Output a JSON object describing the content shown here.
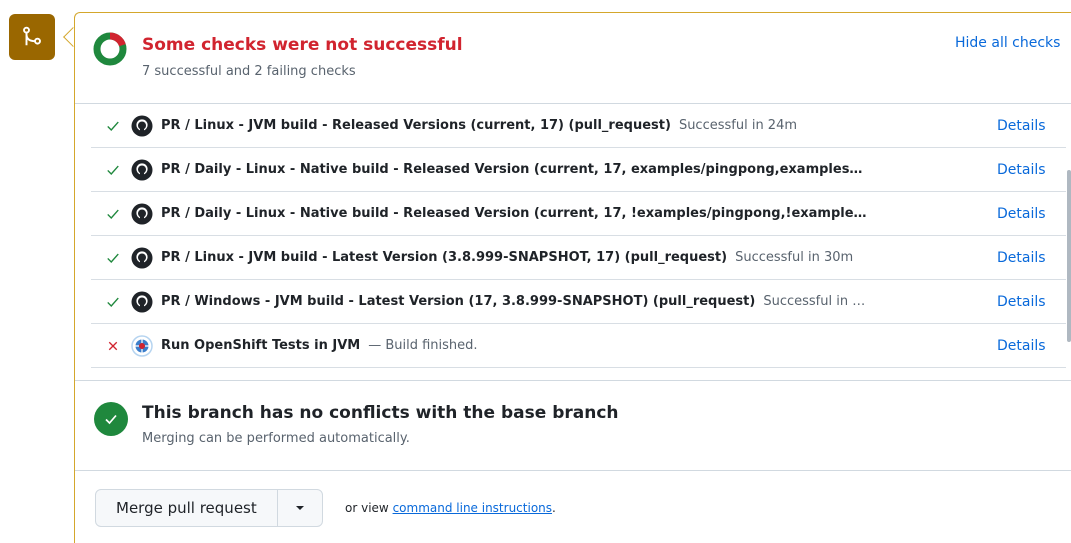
{
  "status": {
    "title": "Some checks were not successful",
    "subtitle": "7 successful and 2 failing checks",
    "hide_label": "Hide all checks",
    "success_color": "#1f883d",
    "fail_color": "#d1242f"
  },
  "checks": [
    {
      "status": "success",
      "avatar": "github-icon",
      "name": "PR / Linux - JVM build - Released Versions (current, 17) (pull_request)",
      "desc": "Successful in 24m",
      "details": "Details"
    },
    {
      "status": "success",
      "avatar": "github-icon",
      "name": "PR / Daily - Linux - Native build - Released Version (current, 17, examples/pingpong,examples…",
      "desc": "",
      "details": "Details"
    },
    {
      "status": "success",
      "avatar": "github-icon",
      "name": "PR / Daily - Linux - Native build - Released Version (current, 17, !examples/pingpong,!example…",
      "desc": "",
      "details": "Details"
    },
    {
      "status": "success",
      "avatar": "github-icon",
      "name": "PR / Linux - JVM build - Latest Version (3.8.999-SNAPSHOT, 17) (pull_request)",
      "desc": "Successful in 30m",
      "details": "Details"
    },
    {
      "status": "success",
      "avatar": "github-icon",
      "name": "PR / Windows - JVM build - Latest Version (17, 3.8.999-SNAPSHOT) (pull_request)",
      "desc": "Successful in …",
      "details": "Details"
    },
    {
      "status": "failure",
      "avatar": "openshift-icon",
      "name": "Run OpenShift Tests in JVM",
      "desc": "— Build finished.",
      "details": "Details"
    }
  ],
  "merge": {
    "title": "This branch has no conflicts with the base branch",
    "subtitle": "Merging can be performed automatically.",
    "button_label": "Merge pull request",
    "or_view": "or view",
    "command_link": "command line instructions",
    "period": "."
  }
}
